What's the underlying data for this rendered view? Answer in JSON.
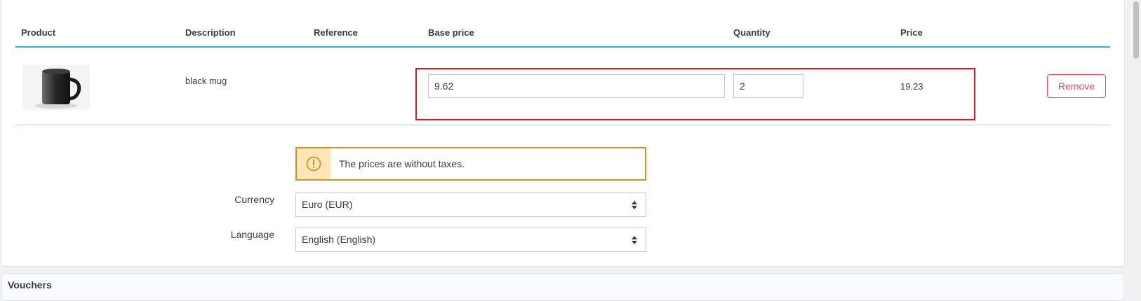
{
  "table": {
    "headers": {
      "product": "Product",
      "description": "Description",
      "reference": "Reference",
      "base_price": "Base price",
      "quantity": "Quantity",
      "price": "Price"
    },
    "rows": [
      {
        "image_icon": "black-mug-image",
        "description": "black mug",
        "reference": "",
        "base_price": "9.62",
        "quantity": "2",
        "price": "19.23",
        "remove_label": "Remove"
      }
    ]
  },
  "alert": {
    "icon": "warning-icon",
    "text": "The prices are without taxes."
  },
  "form": {
    "currency_label": "Currency",
    "currency_value": "Euro (EUR)",
    "language_label": "Language",
    "language_value": "English (English)"
  },
  "next_section": {
    "title": "Vouchers"
  },
  "colors": {
    "accent": "#25b9d7",
    "danger": "#e84e5c",
    "warning": "#cd9321",
    "highlight": "#e4131b"
  }
}
